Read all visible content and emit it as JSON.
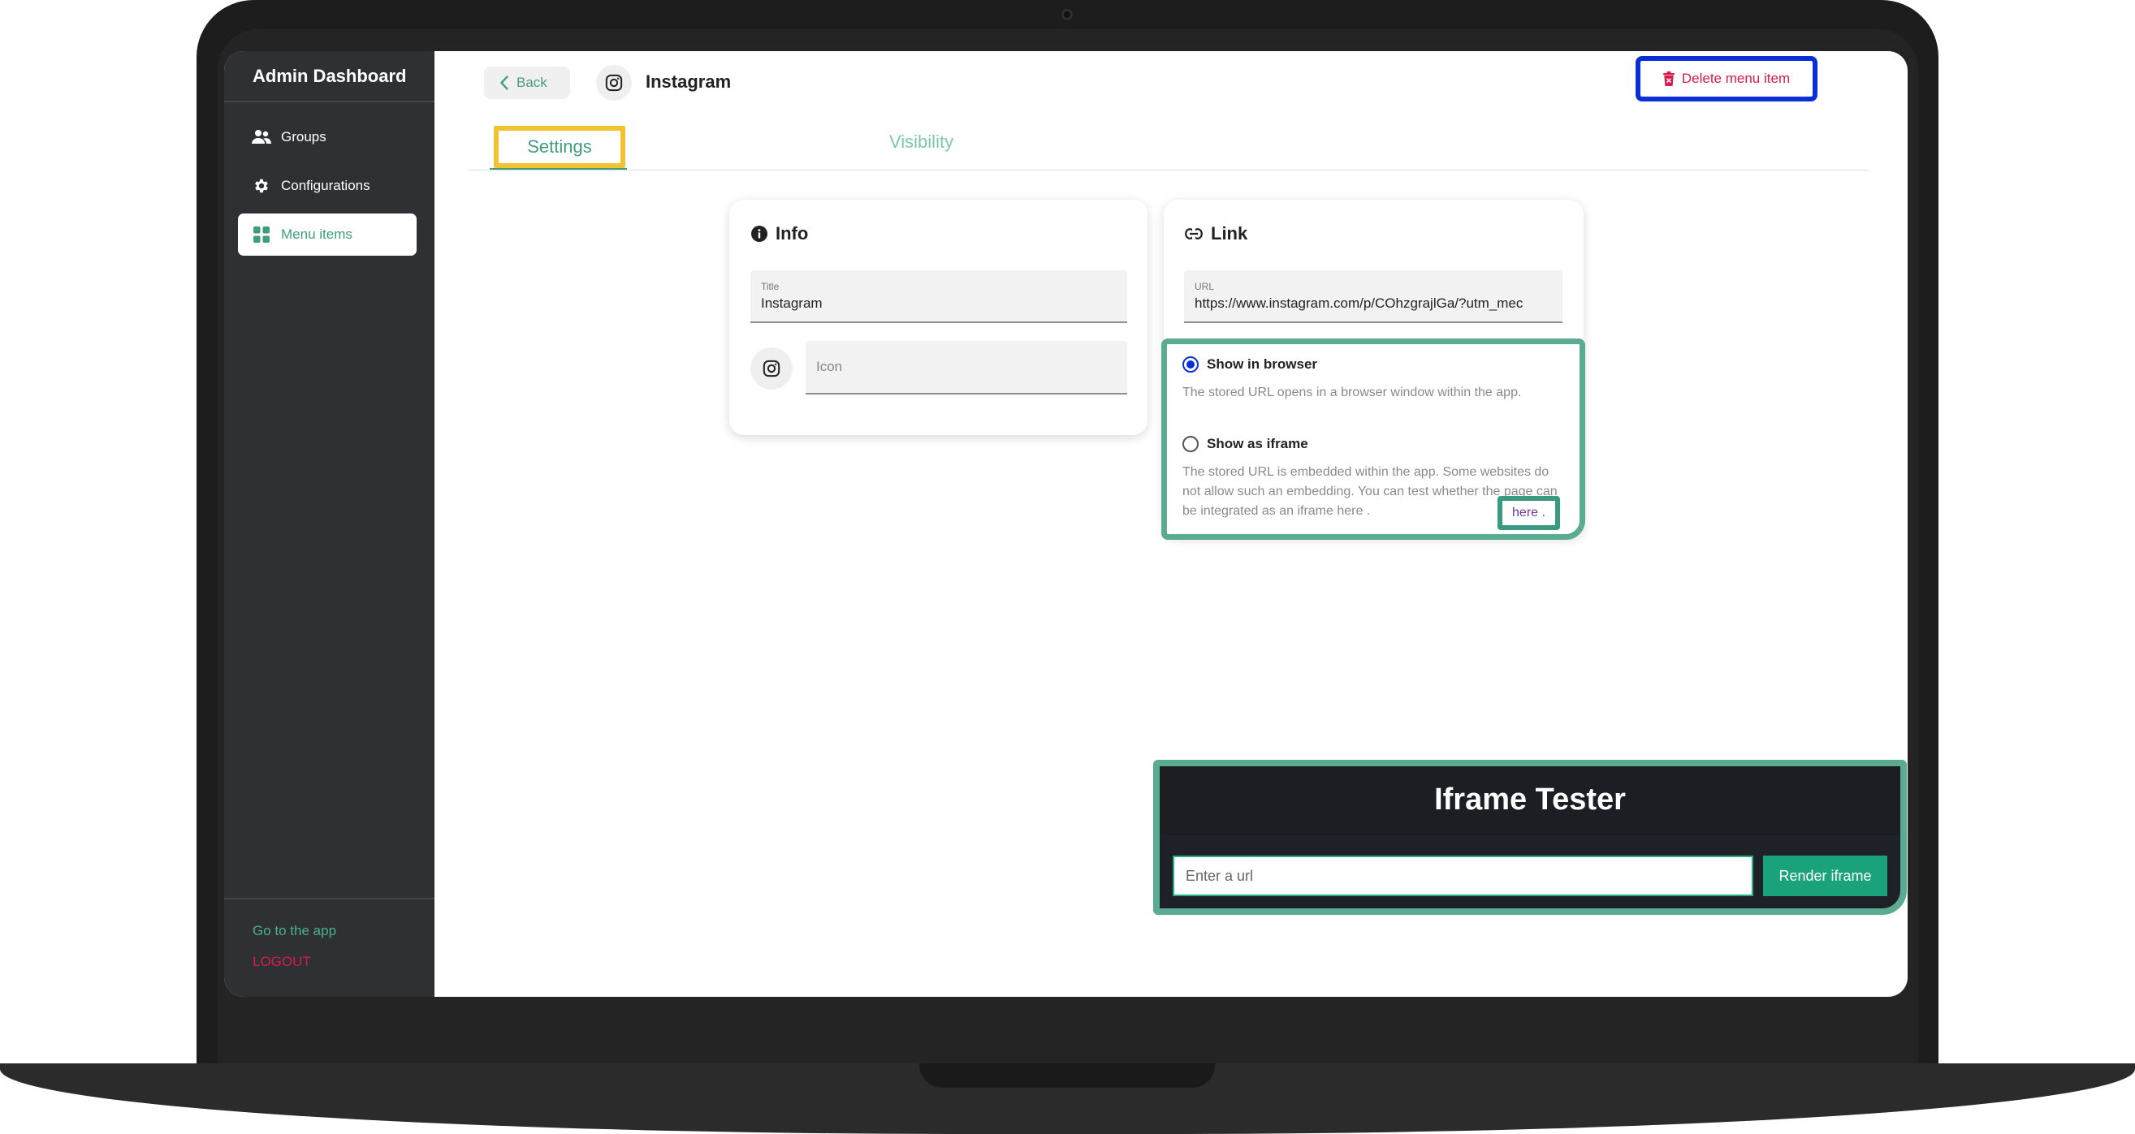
{
  "sidebar": {
    "title": "Admin Dashboard",
    "items": [
      {
        "label": "Groups",
        "icon": "users-icon"
      },
      {
        "label": "Configurations",
        "icon": "gear-icon"
      },
      {
        "label": "Menu items",
        "icon": "grid-icon"
      }
    ],
    "go_to_app": "Go to the app",
    "logout": "LOGOUT"
  },
  "header": {
    "back_label": "Back",
    "title": "Instagram",
    "delete_label": "Delete menu item"
  },
  "tabs": [
    {
      "label": "Settings",
      "active": true
    },
    {
      "label": "Visibility",
      "active": false
    }
  ],
  "info_card": {
    "title": "Info",
    "title_field": {
      "label": "Title",
      "value": "Instagram"
    },
    "icon_field": {
      "placeholder": "Icon"
    }
  },
  "link_card": {
    "title": "Link",
    "url_field": {
      "label": "URL",
      "value": "https://www.instagram.com/p/COhzgrajlGa/?utm_mec"
    },
    "options": [
      {
        "label": "Show in browser",
        "checked": true,
        "description": "The stored URL opens in a browser window within the app."
      },
      {
        "label": "Show as iframe",
        "checked": false,
        "description": "The stored URL is embedded within the app. Some websites do not allow such an embedding. You can test whether the page can be integrated as an iframe here ."
      }
    ],
    "here_link": "here ."
  },
  "iframe_tester": {
    "title": "Iframe Tester",
    "input_placeholder": "Enter a url",
    "button_label": "Render iframe"
  },
  "colors": {
    "sidebar_bg": "#2f3033",
    "accent_green": "#3f9d7e",
    "delete_red": "#d81b4e",
    "highlight_blue": "#0b2fd6",
    "highlight_yellow": "#f1c232",
    "highlight_teal": "#5aab92"
  }
}
